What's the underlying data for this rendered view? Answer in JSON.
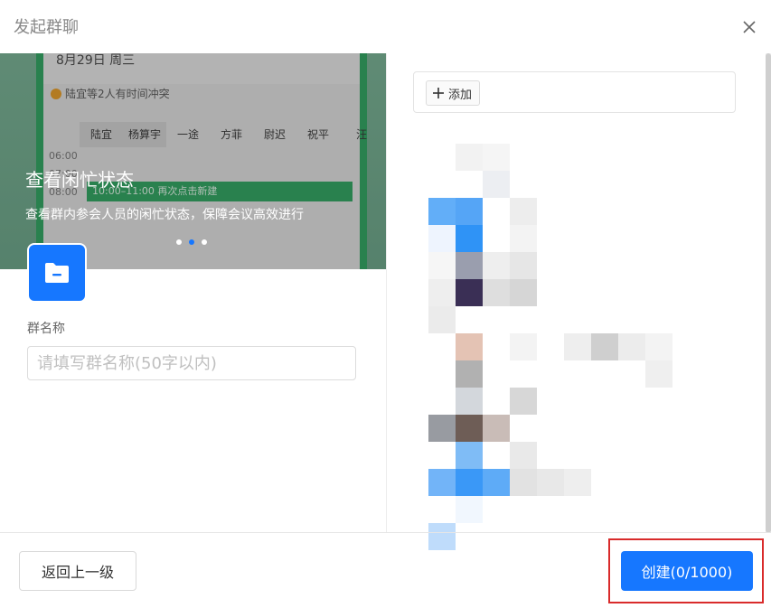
{
  "dialog": {
    "title": "发起群聊"
  },
  "banner": {
    "title": "查看闲忙状态",
    "description": "查看群内参会人员的闲忙状态，保障会议高效进行",
    "mock": {
      "date": "8月29日  周三",
      "conflict": "陆宜等2人有时间冲突",
      "names": [
        "陆宜",
        "杨算宇",
        "一途",
        "方菲",
        "尉迟",
        "祝平",
        "汪"
      ],
      "times": [
        "06:00",
        "07:00",
        "08:00"
      ],
      "event": "10:00–11:00  再次点击新建"
    },
    "dots": 3,
    "active_dot": 1
  },
  "form": {
    "group_name_label": "群名称",
    "group_name_placeholder": "请填写群名称(50字以内)",
    "group_name_value": ""
  },
  "members": {
    "add_label": "添加"
  },
  "footer": {
    "back_label": "返回上一级",
    "create_label": "创建(0/1000)"
  },
  "colors": {
    "primary": "#1677ff",
    "highlight": "#d92b2b",
    "banner_green": "#2aa85f"
  }
}
